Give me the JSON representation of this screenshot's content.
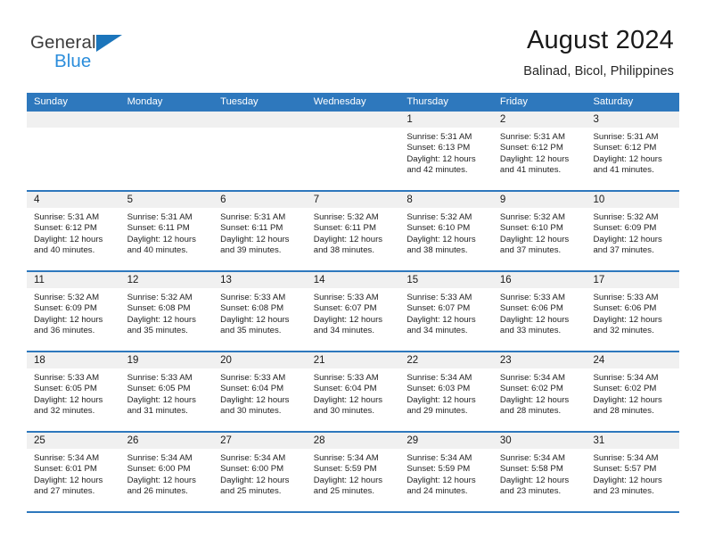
{
  "brand": {
    "name_part1": "General",
    "name_part2": "Blue",
    "flag_icon": "blue-triangle-flag-icon",
    "accent_color": "#2b8ddb"
  },
  "header": {
    "title": "August 2024",
    "location": "Balinad, Bicol, Philippines"
  },
  "theme": {
    "header_blue": "#2e78bd",
    "day_band_gray": "#f0f0f0",
    "text_dark": "#1a1a1a"
  },
  "weekdays": [
    "Sunday",
    "Monday",
    "Tuesday",
    "Wednesday",
    "Thursday",
    "Friday",
    "Saturday"
  ],
  "weeks": [
    [
      {
        "day": "",
        "sunrise": "",
        "sunset": "",
        "daylight": "",
        "empty": true
      },
      {
        "day": "",
        "sunrise": "",
        "sunset": "",
        "daylight": "",
        "empty": true
      },
      {
        "day": "",
        "sunrise": "",
        "sunset": "",
        "daylight": "",
        "empty": true
      },
      {
        "day": "",
        "sunrise": "",
        "sunset": "",
        "daylight": "",
        "empty": true
      },
      {
        "day": "1",
        "sunrise": "Sunrise: 5:31 AM",
        "sunset": "Sunset: 6:13 PM",
        "daylight": "Daylight: 12 hours and 42 minutes."
      },
      {
        "day": "2",
        "sunrise": "Sunrise: 5:31 AM",
        "sunset": "Sunset: 6:12 PM",
        "daylight": "Daylight: 12 hours and 41 minutes."
      },
      {
        "day": "3",
        "sunrise": "Sunrise: 5:31 AM",
        "sunset": "Sunset: 6:12 PM",
        "daylight": "Daylight: 12 hours and 41 minutes."
      }
    ],
    [
      {
        "day": "4",
        "sunrise": "Sunrise: 5:31 AM",
        "sunset": "Sunset: 6:12 PM",
        "daylight": "Daylight: 12 hours and 40 minutes."
      },
      {
        "day": "5",
        "sunrise": "Sunrise: 5:31 AM",
        "sunset": "Sunset: 6:11 PM",
        "daylight": "Daylight: 12 hours and 40 minutes."
      },
      {
        "day": "6",
        "sunrise": "Sunrise: 5:31 AM",
        "sunset": "Sunset: 6:11 PM",
        "daylight": "Daylight: 12 hours and 39 minutes."
      },
      {
        "day": "7",
        "sunrise": "Sunrise: 5:32 AM",
        "sunset": "Sunset: 6:11 PM",
        "daylight": "Daylight: 12 hours and 38 minutes."
      },
      {
        "day": "8",
        "sunrise": "Sunrise: 5:32 AM",
        "sunset": "Sunset: 6:10 PM",
        "daylight": "Daylight: 12 hours and 38 minutes."
      },
      {
        "day": "9",
        "sunrise": "Sunrise: 5:32 AM",
        "sunset": "Sunset: 6:10 PM",
        "daylight": "Daylight: 12 hours and 37 minutes."
      },
      {
        "day": "10",
        "sunrise": "Sunrise: 5:32 AM",
        "sunset": "Sunset: 6:09 PM",
        "daylight": "Daylight: 12 hours and 37 minutes."
      }
    ],
    [
      {
        "day": "11",
        "sunrise": "Sunrise: 5:32 AM",
        "sunset": "Sunset: 6:09 PM",
        "daylight": "Daylight: 12 hours and 36 minutes."
      },
      {
        "day": "12",
        "sunrise": "Sunrise: 5:32 AM",
        "sunset": "Sunset: 6:08 PM",
        "daylight": "Daylight: 12 hours and 35 minutes."
      },
      {
        "day": "13",
        "sunrise": "Sunrise: 5:33 AM",
        "sunset": "Sunset: 6:08 PM",
        "daylight": "Daylight: 12 hours and 35 minutes."
      },
      {
        "day": "14",
        "sunrise": "Sunrise: 5:33 AM",
        "sunset": "Sunset: 6:07 PM",
        "daylight": "Daylight: 12 hours and 34 minutes."
      },
      {
        "day": "15",
        "sunrise": "Sunrise: 5:33 AM",
        "sunset": "Sunset: 6:07 PM",
        "daylight": "Daylight: 12 hours and 34 minutes."
      },
      {
        "day": "16",
        "sunrise": "Sunrise: 5:33 AM",
        "sunset": "Sunset: 6:06 PM",
        "daylight": "Daylight: 12 hours and 33 minutes."
      },
      {
        "day": "17",
        "sunrise": "Sunrise: 5:33 AM",
        "sunset": "Sunset: 6:06 PM",
        "daylight": "Daylight: 12 hours and 32 minutes."
      }
    ],
    [
      {
        "day": "18",
        "sunrise": "Sunrise: 5:33 AM",
        "sunset": "Sunset: 6:05 PM",
        "daylight": "Daylight: 12 hours and 32 minutes."
      },
      {
        "day": "19",
        "sunrise": "Sunrise: 5:33 AM",
        "sunset": "Sunset: 6:05 PM",
        "daylight": "Daylight: 12 hours and 31 minutes."
      },
      {
        "day": "20",
        "sunrise": "Sunrise: 5:33 AM",
        "sunset": "Sunset: 6:04 PM",
        "daylight": "Daylight: 12 hours and 30 minutes."
      },
      {
        "day": "21",
        "sunrise": "Sunrise: 5:33 AM",
        "sunset": "Sunset: 6:04 PM",
        "daylight": "Daylight: 12 hours and 30 minutes."
      },
      {
        "day": "22",
        "sunrise": "Sunrise: 5:34 AM",
        "sunset": "Sunset: 6:03 PM",
        "daylight": "Daylight: 12 hours and 29 minutes."
      },
      {
        "day": "23",
        "sunrise": "Sunrise: 5:34 AM",
        "sunset": "Sunset: 6:02 PM",
        "daylight": "Daylight: 12 hours and 28 minutes."
      },
      {
        "day": "24",
        "sunrise": "Sunrise: 5:34 AM",
        "sunset": "Sunset: 6:02 PM",
        "daylight": "Daylight: 12 hours and 28 minutes."
      }
    ],
    [
      {
        "day": "25",
        "sunrise": "Sunrise: 5:34 AM",
        "sunset": "Sunset: 6:01 PM",
        "daylight": "Daylight: 12 hours and 27 minutes."
      },
      {
        "day": "26",
        "sunrise": "Sunrise: 5:34 AM",
        "sunset": "Sunset: 6:00 PM",
        "daylight": "Daylight: 12 hours and 26 minutes."
      },
      {
        "day": "27",
        "sunrise": "Sunrise: 5:34 AM",
        "sunset": "Sunset: 6:00 PM",
        "daylight": "Daylight: 12 hours and 25 minutes."
      },
      {
        "day": "28",
        "sunrise": "Sunrise: 5:34 AM",
        "sunset": "Sunset: 5:59 PM",
        "daylight": "Daylight: 12 hours and 25 minutes."
      },
      {
        "day": "29",
        "sunrise": "Sunrise: 5:34 AM",
        "sunset": "Sunset: 5:59 PM",
        "daylight": "Daylight: 12 hours and 24 minutes."
      },
      {
        "day": "30",
        "sunrise": "Sunrise: 5:34 AM",
        "sunset": "Sunset: 5:58 PM",
        "daylight": "Daylight: 12 hours and 23 minutes."
      },
      {
        "day": "31",
        "sunrise": "Sunrise: 5:34 AM",
        "sunset": "Sunset: 5:57 PM",
        "daylight": "Daylight: 12 hours and 23 minutes."
      }
    ]
  ]
}
